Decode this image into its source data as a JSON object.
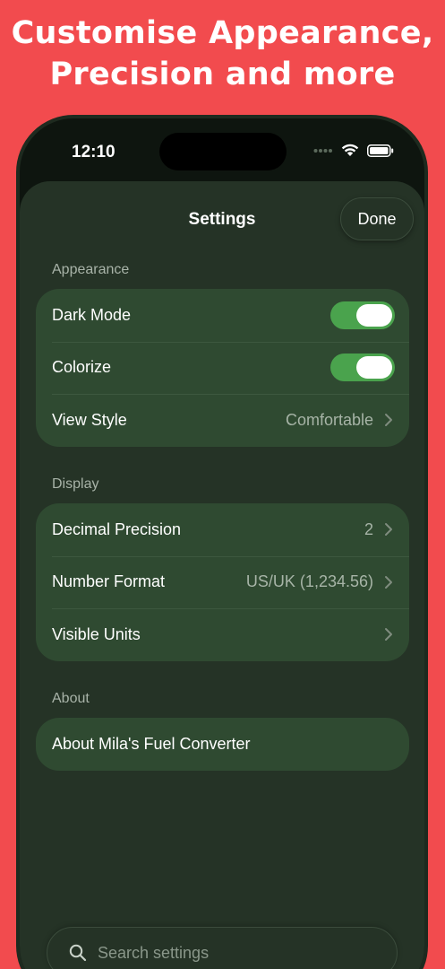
{
  "headline": {
    "line1": "Customise Appearance,",
    "line2": "Precision and more"
  },
  "status_bar": {
    "time": "12:10"
  },
  "header": {
    "title": "Settings",
    "done_label": "Done"
  },
  "sections": {
    "appearance": {
      "label": "Appearance",
      "dark_mode": {
        "label": "Dark Mode",
        "on": true
      },
      "colorize": {
        "label": "Colorize",
        "on": true
      },
      "view_style": {
        "label": "View Style",
        "value": "Comfortable"
      }
    },
    "display": {
      "label": "Display",
      "decimal_precision": {
        "label": "Decimal Precision",
        "value": "2"
      },
      "number_format": {
        "label": "Number Format",
        "value": "US/UK (1,234.56)"
      },
      "visible_units": {
        "label": "Visible Units"
      }
    },
    "about": {
      "label": "About",
      "about_app": {
        "label": "About Mila's Fuel Converter"
      }
    }
  },
  "search": {
    "placeholder": "Search settings",
    "value": ""
  },
  "colors": {
    "background": "#f24b4e",
    "sheet": "#253326",
    "group": "#2f4a31",
    "toggle_on": "#4aa34d"
  }
}
